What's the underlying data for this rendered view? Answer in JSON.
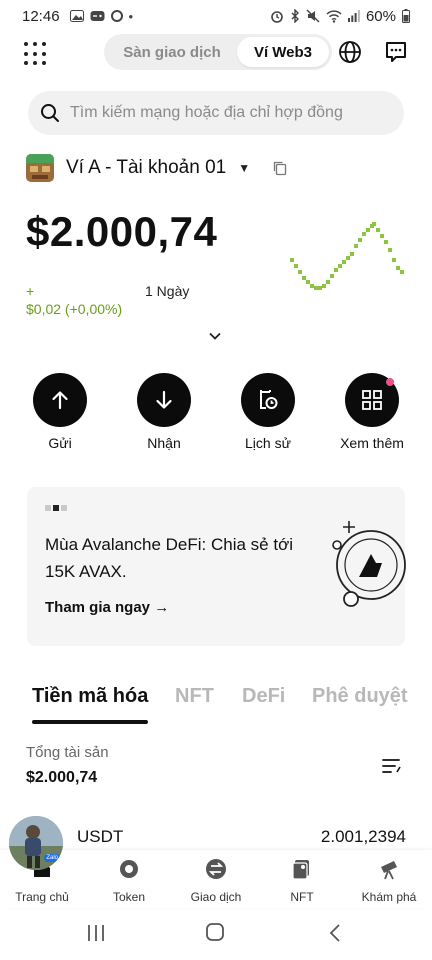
{
  "statusbar": {
    "time": "12:46",
    "left_marker": "•",
    "battery": "60%"
  },
  "topnav": {
    "tab_exchange": "Sàn giao dịch",
    "tab_web3": "Ví Web3"
  },
  "search": {
    "placeholder": "Tìm kiếm mạng hoặc địa chỉ hợp đồng"
  },
  "account": {
    "name": "Ví A - Tài khoản 01"
  },
  "balance": {
    "total": "$2.000,74",
    "change_sign": "+",
    "change_text": "$0,02 (+0,00%)",
    "period": "1 Ngày"
  },
  "actions": [
    {
      "label": "Gửi",
      "icon": "arrow-up-icon"
    },
    {
      "label": "Nhận",
      "icon": "arrow-down-icon"
    },
    {
      "label": "Lịch sử",
      "icon": "history-icon"
    },
    {
      "label": "Xem thêm",
      "icon": "grid-more-icon"
    }
  ],
  "promo": {
    "text": "Mùa Avalanche DeFi: Chia sẻ tới 15K AVAX.",
    "cta": "Tham gia ngay",
    "cta_arrow": "→"
  },
  "tabs": [
    "Tiền mã hóa",
    "NFT",
    "DeFi",
    "Phê duyệt"
  ],
  "assets": {
    "label": "Tổng tài sản",
    "value": "$2.000,74"
  },
  "tokens": [
    {
      "symbol": "USDT",
      "amount": "2.001,2394"
    }
  ],
  "photo_badge": "Zalo",
  "bottomnav": [
    {
      "label": "Trang chủ"
    },
    {
      "label": "Token"
    },
    {
      "label": "Giao dịch"
    },
    {
      "label": "NFT"
    },
    {
      "label": "Khám phá"
    }
  ],
  "colors": {
    "accent_green": "#6a9e1a",
    "notify_pink": "#f04e86",
    "chart_green": "#8cc63f"
  }
}
